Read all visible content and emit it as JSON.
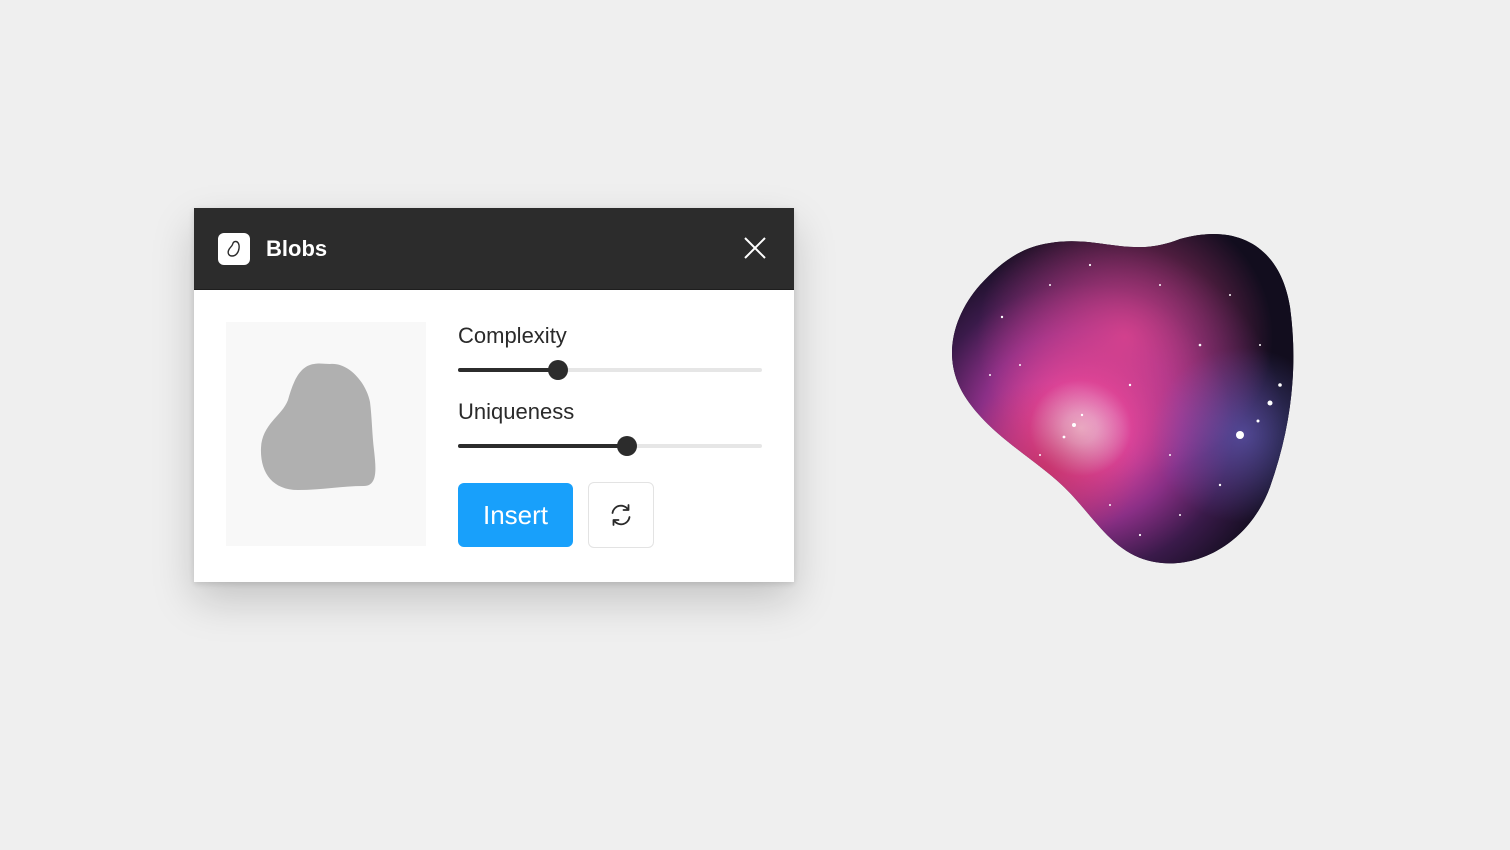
{
  "window": {
    "title": "Blobs",
    "app_icon": "blob-icon",
    "close_icon": "close-icon"
  },
  "preview": {
    "blob_color": "#b0b0b0",
    "background": "#f8f8f8"
  },
  "controls": {
    "complexity": {
      "label": "Complexity",
      "value_fraction": 0.33
    },
    "uniqueness": {
      "label": "Uniqueness",
      "value_fraction": 0.555
    }
  },
  "buttons": {
    "insert_label": "Insert",
    "refresh_icon": "refresh-icon"
  },
  "colors": {
    "titlebar": "#2c2c2c",
    "accent": "#18a0fb",
    "slider_active": "#2c2c2c",
    "slider_track": "#e6e6e6",
    "canvas": "#efefef"
  },
  "canvas_object": {
    "type": "image-filled-blob",
    "image_subject": "nebula"
  }
}
